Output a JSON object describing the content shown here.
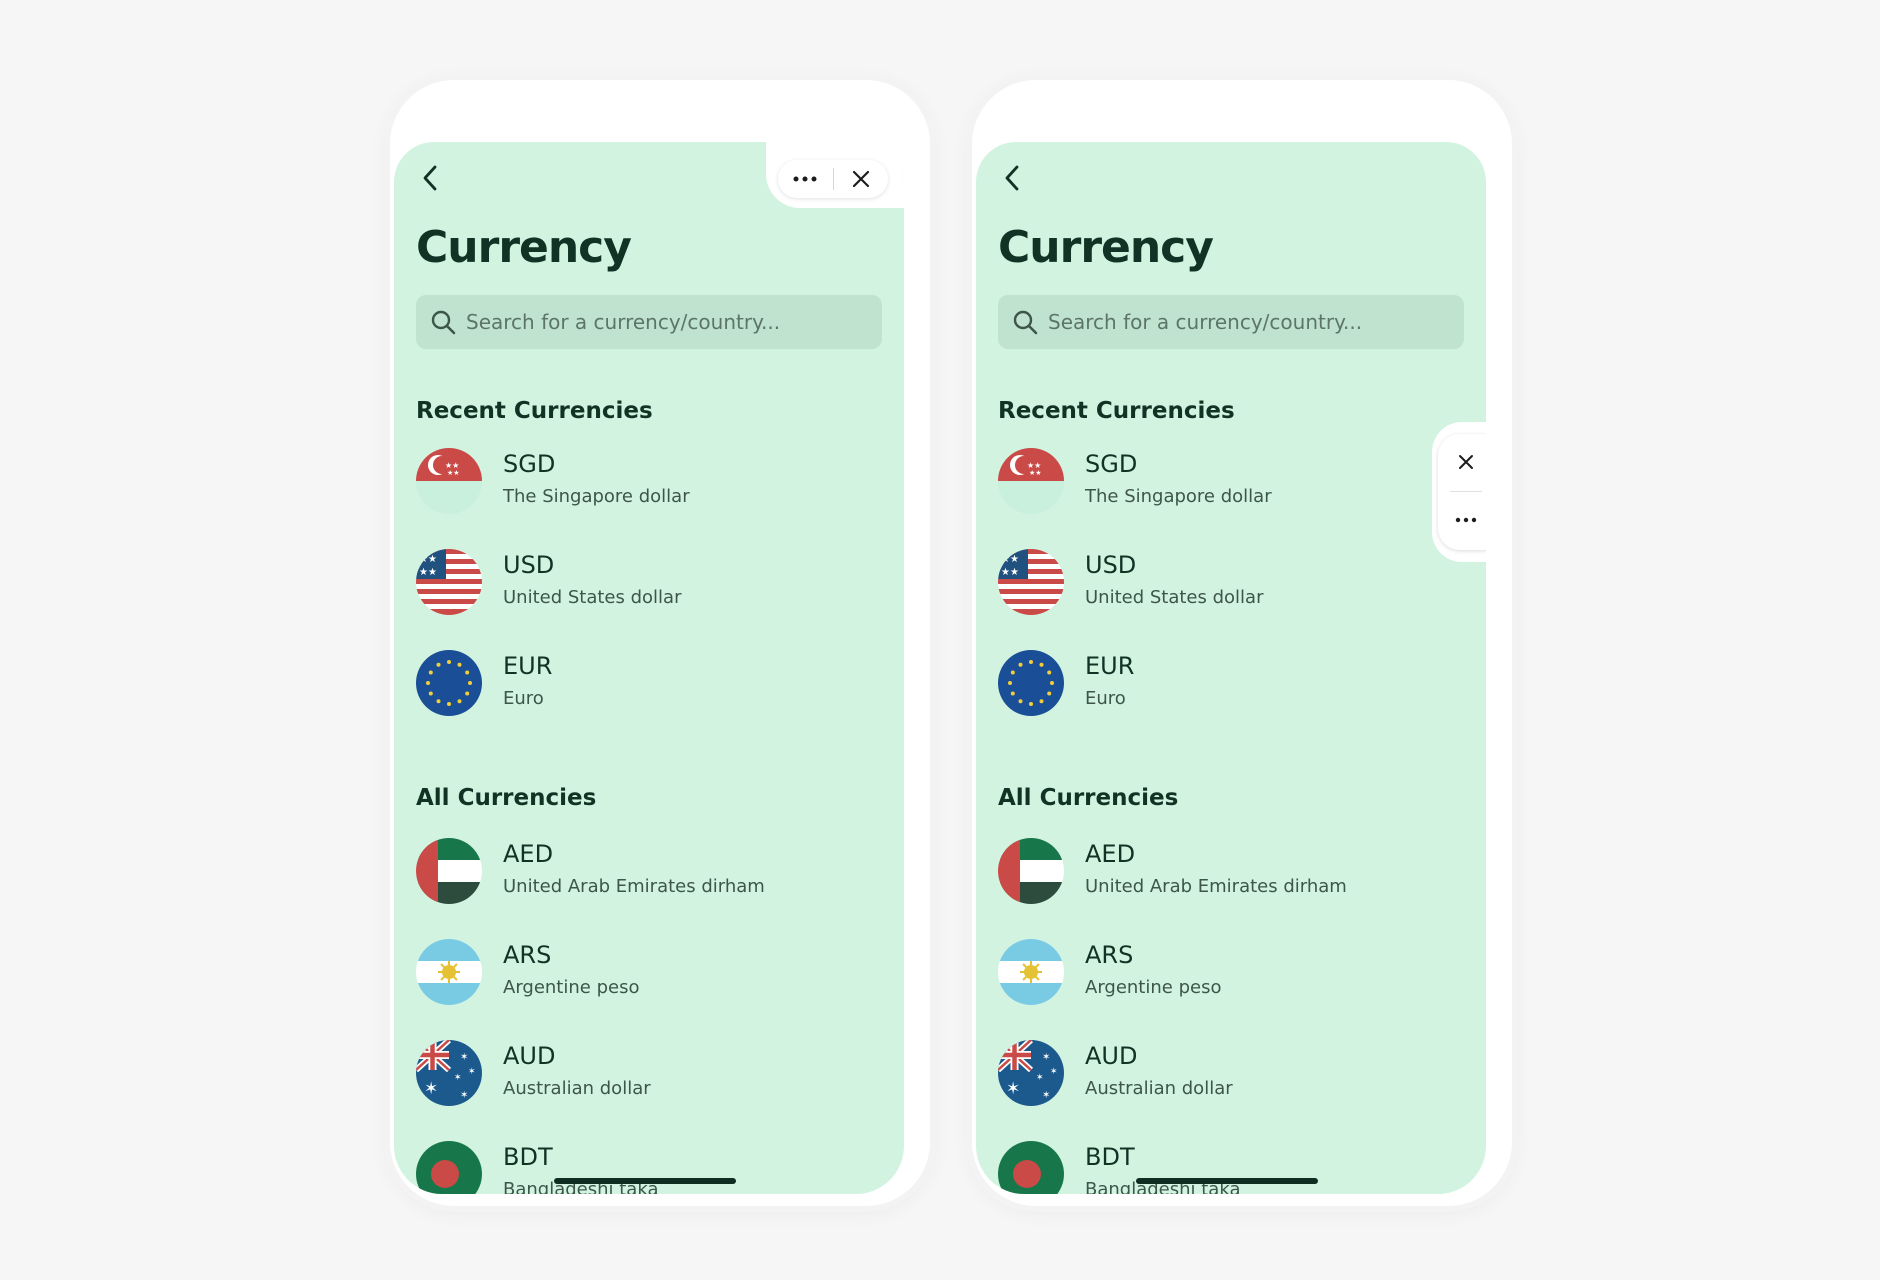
{
  "screen": {
    "title": "Currency",
    "search_placeholder": "Search for a currency/country...",
    "recent_title": "Recent Currencies",
    "all_title": "All Currencies",
    "recent": [
      {
        "code": "SGD",
        "name": "The Singapore dollar",
        "flag": "singapore-flag-icon"
      },
      {
        "code": "USD",
        "name": "United States dollar",
        "flag": "usa-flag-icon"
      },
      {
        "code": "EUR",
        "name": "Euro",
        "flag": "eu-flag-icon"
      }
    ],
    "all": [
      {
        "code": "AED",
        "name": "United Arab Emirates dirham",
        "flag": "uae-flag-icon"
      },
      {
        "code": "ARS",
        "name": "Argentine peso",
        "flag": "argentina-flag-icon"
      },
      {
        "code": "AUD",
        "name": "Australian dollar",
        "flag": "australia-flag-icon"
      },
      {
        "code": "BDT",
        "name": "Bangladeshi taka",
        "flag": "bangladesh-flag-icon"
      }
    ]
  },
  "icons": {
    "back": "chevron-left-icon",
    "more": "more-dots-icon",
    "close": "close-icon",
    "search": "search-icon"
  },
  "colors": {
    "screen_bg": "#d2f3e0",
    "search_bg": "#bfe3cf",
    "text_dark": "#113325",
    "text_muted": "#3d5649",
    "page_bg": "#f6f6f6"
  }
}
